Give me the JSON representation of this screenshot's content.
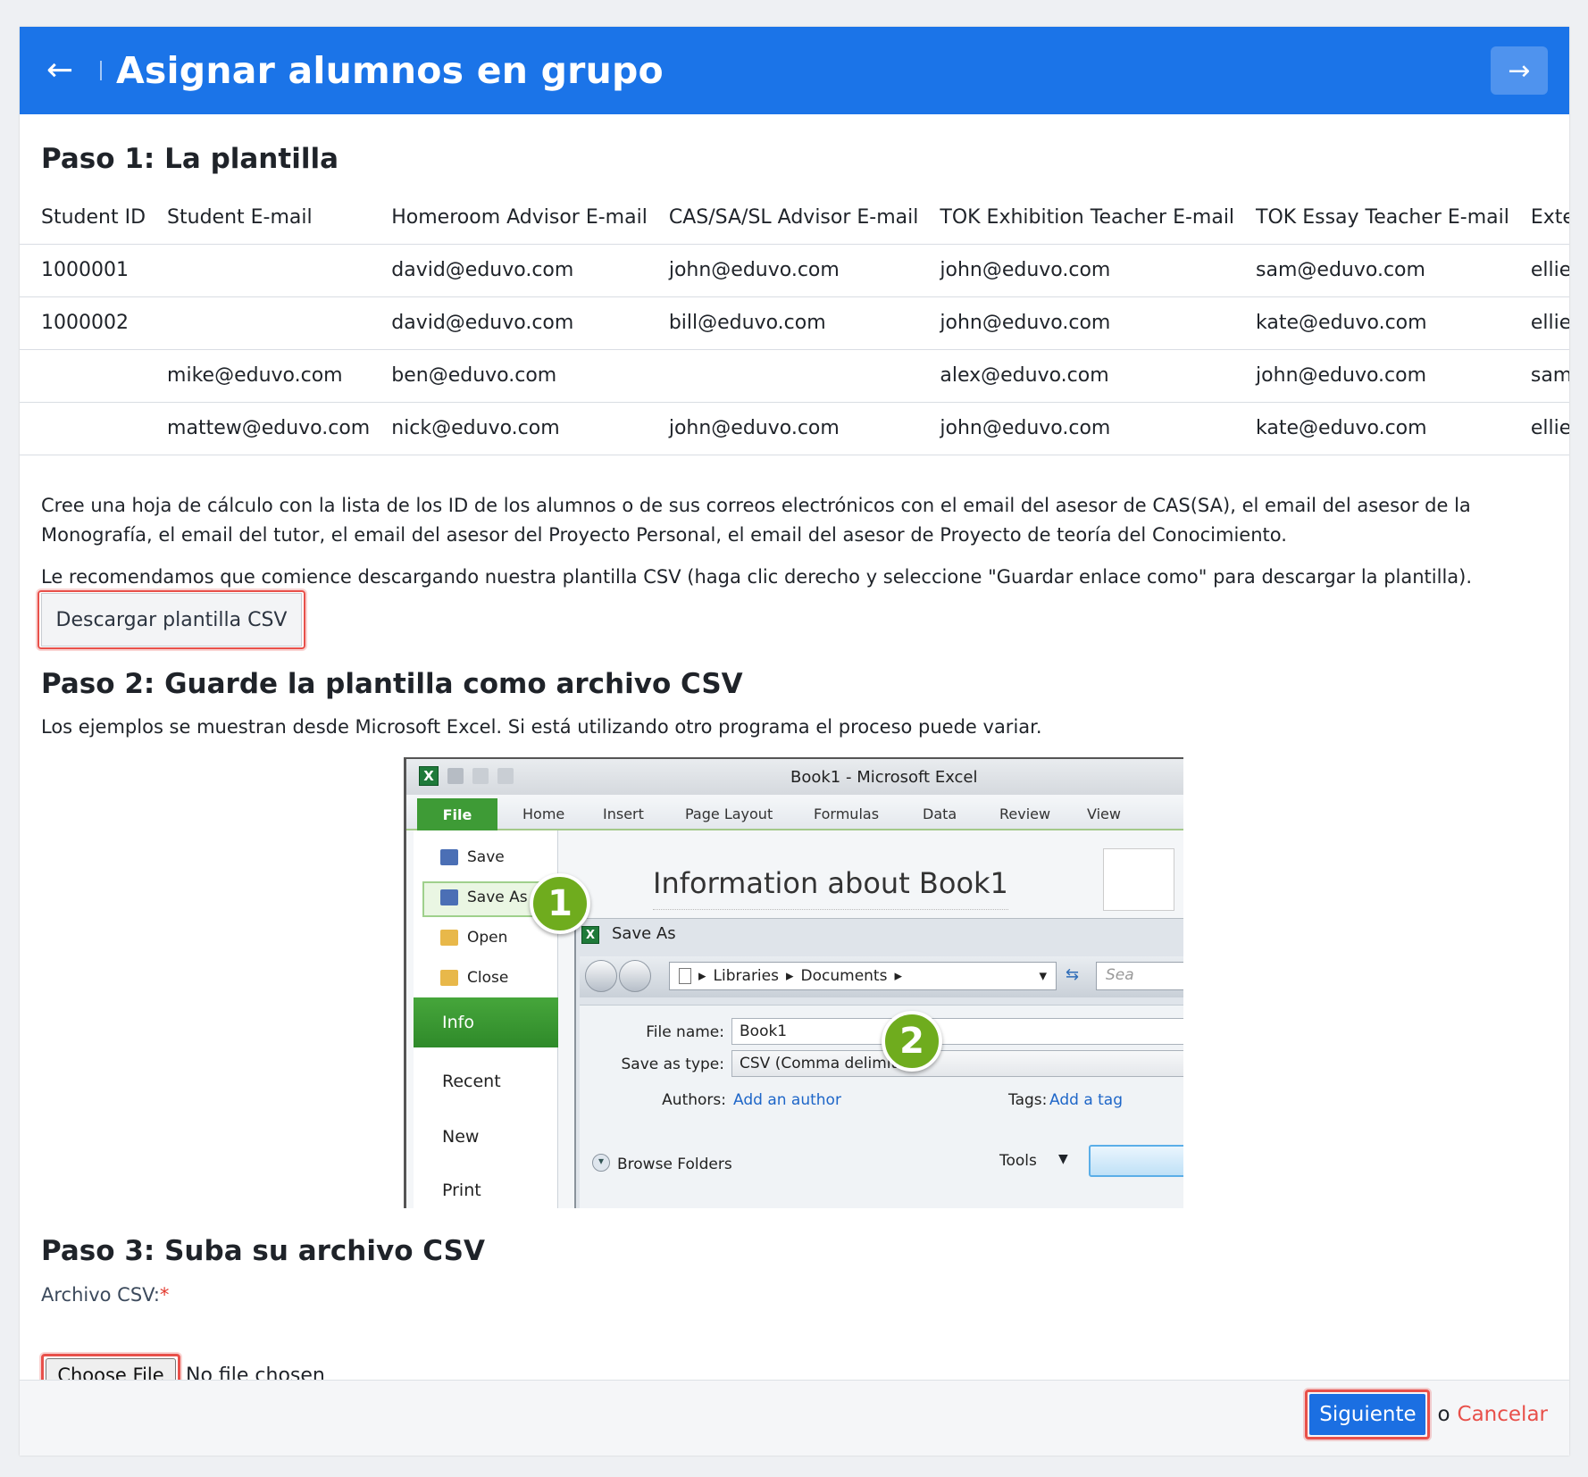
{
  "header": {
    "title": "Asignar alumnos en grupo",
    "back_icon": "arrow-left-icon",
    "next_icon": "arrow-right-icon"
  },
  "step1": {
    "title": "Paso 1: La plantilla",
    "table": {
      "columns": [
        "Student ID",
        "Student E-mail",
        "Homeroom Advisor E-mail",
        "CAS/SA/SL Advisor E-mail",
        "TOK Exhibition Teacher E-mail",
        "TOK Essay Teacher E-mail",
        "Extended"
      ],
      "rows": [
        [
          "1000001",
          "",
          "david@eduvo.com",
          "john@eduvo.com",
          "john@eduvo.com",
          "sam@eduvo.com",
          "ellie@edu"
        ],
        [
          "1000002",
          "",
          "david@eduvo.com",
          "bill@eduvo.com",
          "john@eduvo.com",
          "kate@eduvo.com",
          "ellie@edu"
        ],
        [
          "",
          "mike@eduvo.com",
          "ben@eduvo.com",
          "",
          "alex@eduvo.com",
          "john@eduvo.com",
          "sam@edu"
        ],
        [
          "",
          "mattew@eduvo.com",
          "nick@eduvo.com",
          "john@eduvo.com",
          "john@eduvo.com",
          "kate@eduvo.com",
          "ellie@edu"
        ]
      ]
    },
    "desc1": "Cree una hoja de cálculo con la lista de los ID de los alumnos o de sus correos electrónicos con el email del asesor de CAS(SA), el email del asesor de la Monografía, el email del tutor, el email del asesor del Proyecto Personal, el email del asesor de Proyecto de teoría del Conocimiento.",
    "desc2": "Le recomendamos que comience descargando nuestra plantilla CSV (haga clic derecho y seleccione \"Guardar enlace como\" para descargar la plantilla).",
    "download_label": "Descargar plantilla CSV"
  },
  "step2": {
    "title": "Paso 2: Guarde la plantilla como archivo CSV",
    "desc": "Los ejemplos se muestran desde Microsoft Excel. Si está utilizando otro programa el proceso puede variar.",
    "excel": {
      "window_title": "Book1  -  Microsoft Excel",
      "tabs": [
        "File",
        "Home",
        "Insert",
        "Page Layout",
        "Formulas",
        "Data",
        "Review",
        "View"
      ],
      "menu": [
        "Save",
        "Save As",
        "Open",
        "Close"
      ],
      "sections": [
        "Info",
        "Recent",
        "New",
        "Print"
      ],
      "main_title": "Information about Book1",
      "dialog_title": "Save As",
      "path": [
        "Libraries",
        "Documents"
      ],
      "search_placeholder": "Sea",
      "file_name_label": "File name:",
      "file_name": "Book1",
      "save_type_label": "Save as type:",
      "save_type": "CSV (Comma delimited)",
      "authors_label": "Authors:",
      "authors_link": "Add an author",
      "tags_label": "Tags:",
      "tags_link": "Add a tag",
      "browse_label": "Browse Folders",
      "tools_label": "Tools",
      "badge1": "1",
      "badge2": "2"
    }
  },
  "step3": {
    "title": "Paso 3: Suba su archivo CSV",
    "field_label": "Archivo CSV:",
    "required_mark": "*",
    "choose_label": "Choose File",
    "no_file": "No file chosen"
  },
  "footer": {
    "submit_label": "Siguiente",
    "or_text": "o",
    "cancel_label": "Cancelar"
  },
  "colors": {
    "primary": "#1b74e8",
    "highlight": "#e8504a",
    "cancel": "#e8504a",
    "excel_green": "#3e9b36",
    "badge_green": "#6fac1e"
  }
}
